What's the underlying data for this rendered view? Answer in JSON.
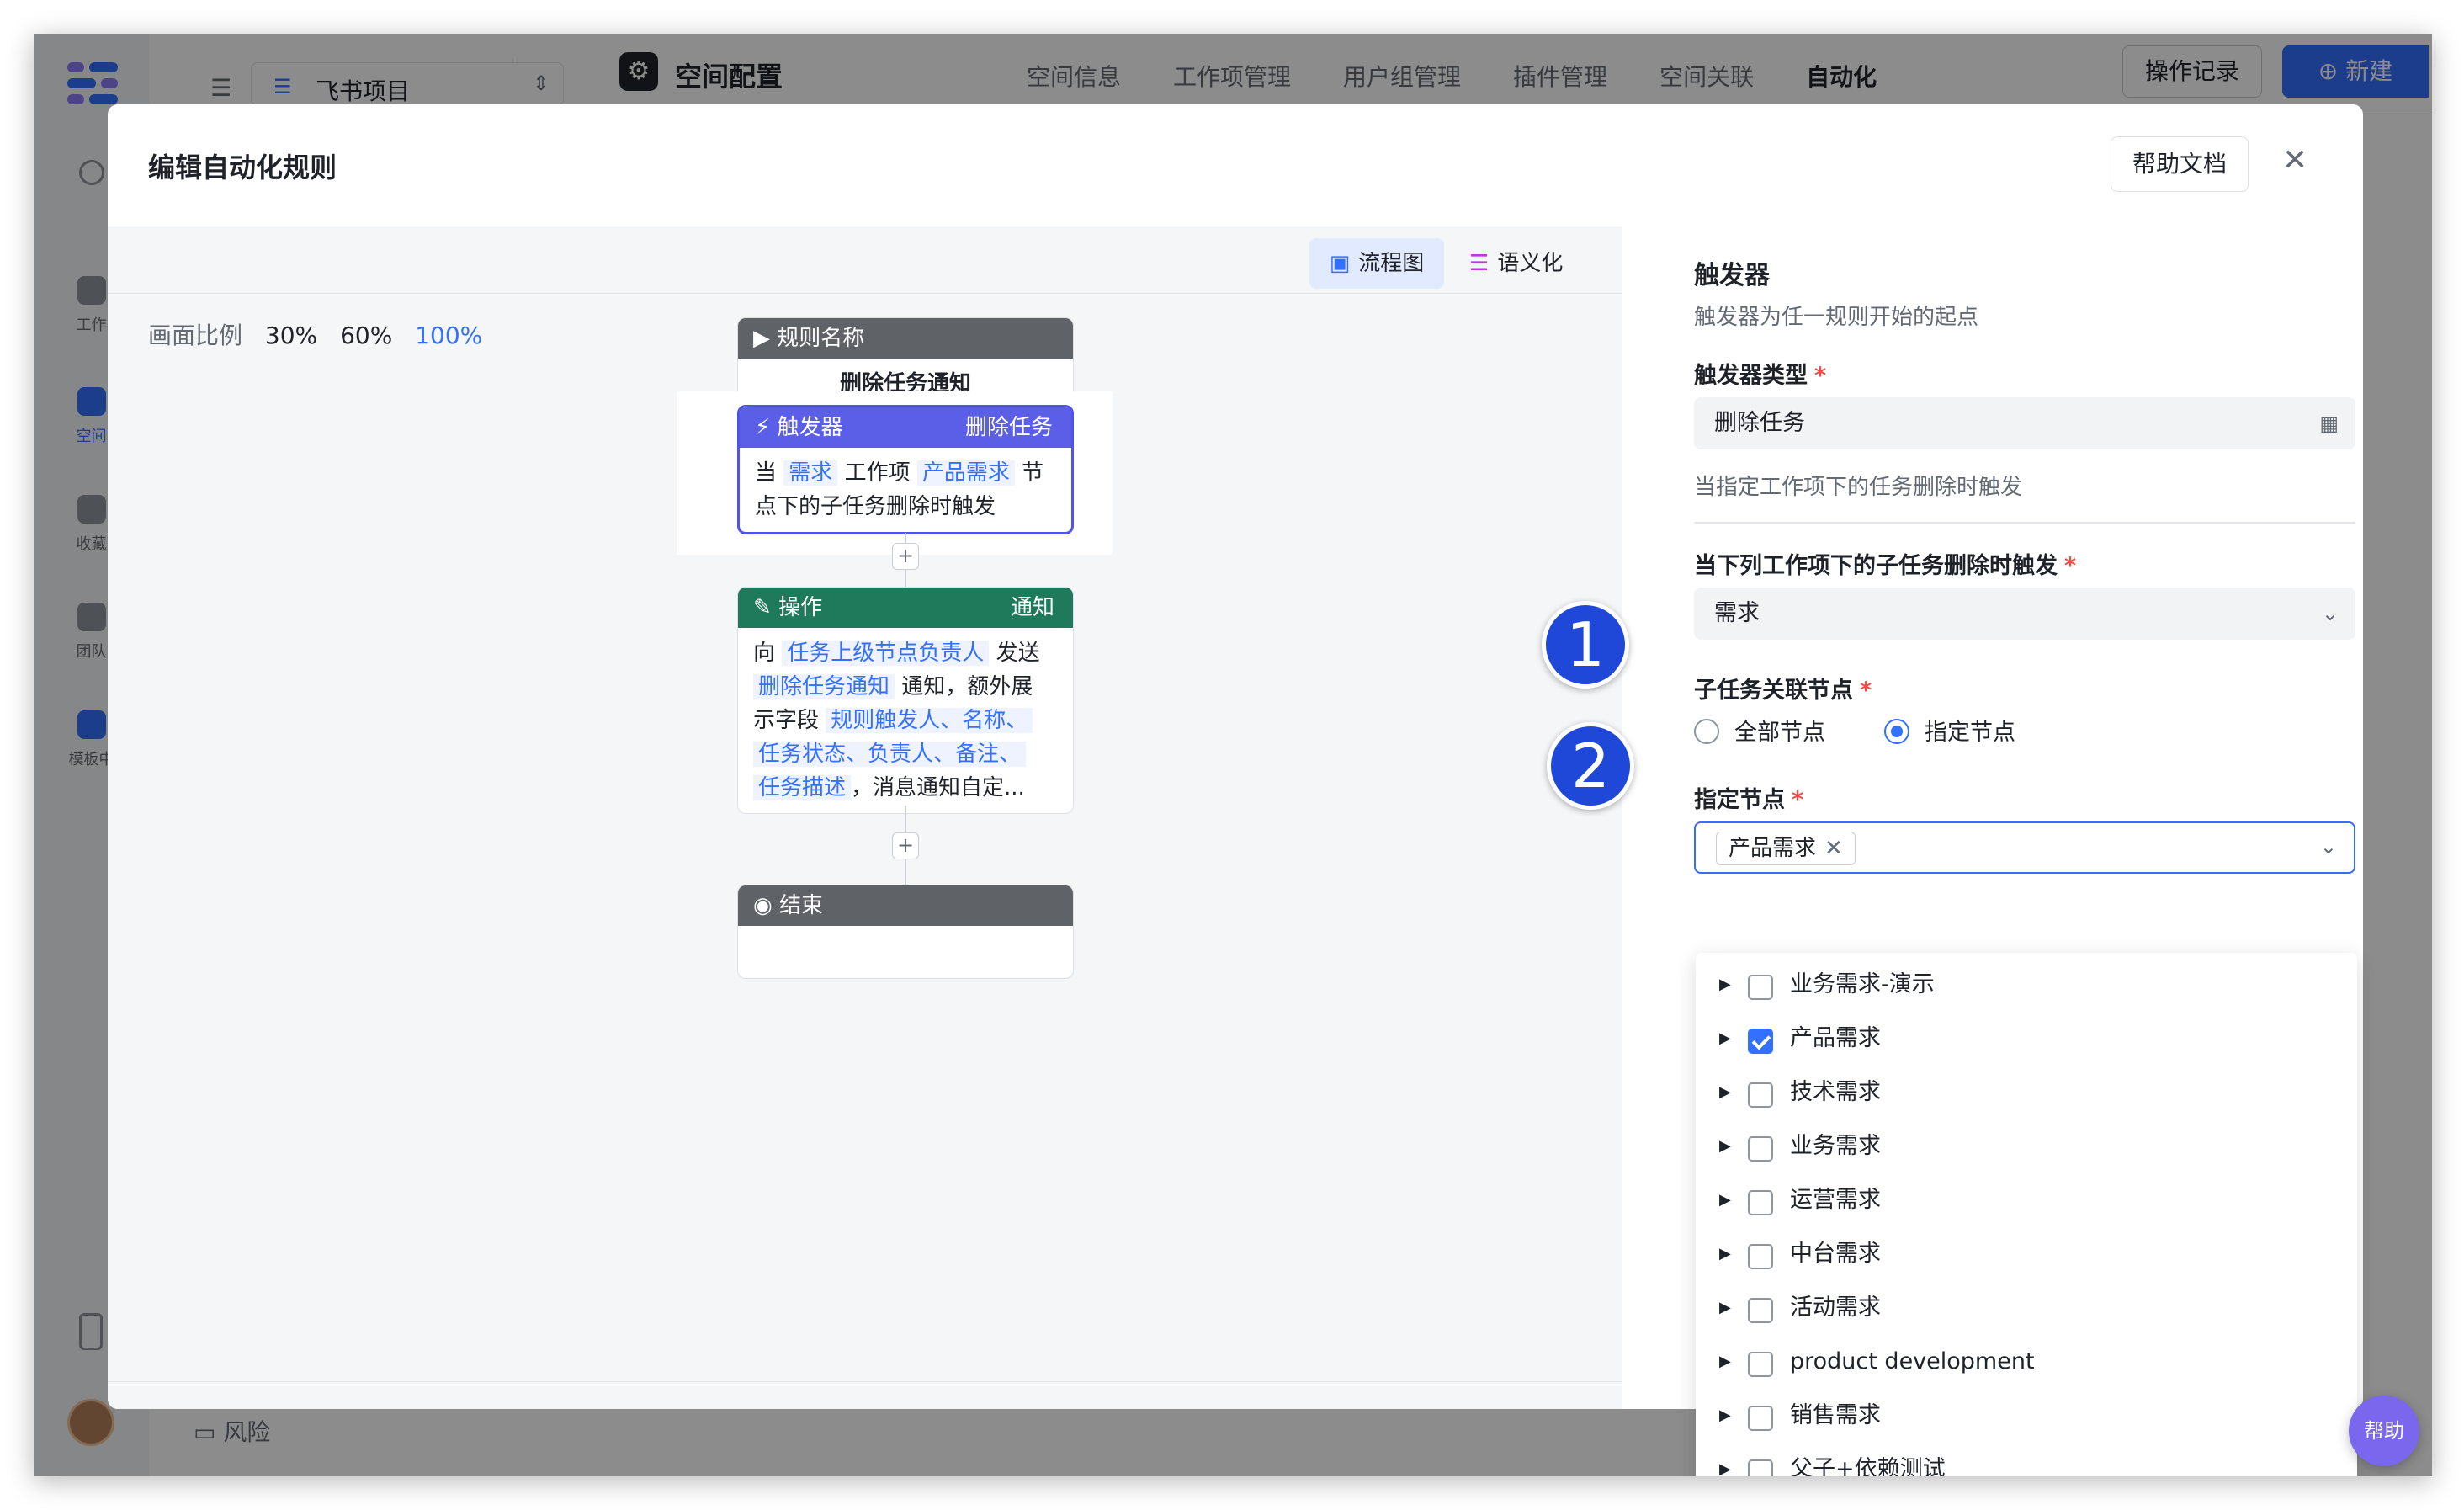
{
  "app": {
    "project_name": "飞书项目",
    "space_title": "空间配置",
    "tabs": [
      "空间信息",
      "工作项管理",
      "用户组管理",
      "插件管理",
      "空间关联",
      "自动化"
    ],
    "active_tab": "自动化",
    "operation_log": "操作记录",
    "new_button": "新建",
    "sidebar": [
      "工作",
      "空间",
      "收藏",
      "团队",
      "模板中"
    ],
    "bottom_item": "风险"
  },
  "modal": {
    "title": "编辑自动化规则",
    "help_doc": "帮助文档",
    "close": "✕",
    "views": {
      "flow": "流程图",
      "semantic": "语义化"
    },
    "zoom_label": "画面比例",
    "zoom_options": [
      "30%",
      "60%",
      "100%"
    ],
    "zoom_selected": "100%"
  },
  "flow": {
    "rule_name_header": "规则名称",
    "rule_name": "删除任务通知",
    "trigger": {
      "header": "触发器",
      "type": "删除任务",
      "p1": "当",
      "v1": "需求",
      "p2": "工作项",
      "v2": "产品需求",
      "p3": "节",
      "line2": "点下的子任务删除时触发"
    },
    "action": {
      "header": "操作",
      "type": "通知",
      "p1": "向",
      "v1": "任务上级节点负责人",
      "p2": "发送",
      "v2": "删除任务通知",
      "p3": "通知，额外展",
      "p4": "示字段",
      "v3": "规则触发人、名称、",
      "v4": "任务状态、负责人、备注、",
      "v5": "任务描述",
      "p5": "，消息通知自定..."
    },
    "end": "结束",
    "plus": "+"
  },
  "panel": {
    "title": "触发器",
    "desc": "触发器为任一规则开始的起点",
    "type_label": "触发器类型",
    "type_value": "删除任务",
    "type_hint": "当指定工作项下的任务删除时触发",
    "workitem_label": "当下列工作项下的子任务删除时触发",
    "workitem_value": "需求",
    "node_label": "子任务关联节点",
    "radio_all": "全部节点",
    "radio_specified": "指定节点",
    "specified_label": "指定节点",
    "required": "*",
    "selected_tag": "产品需求",
    "options": [
      {
        "label": "业务需求-演示",
        "checked": false
      },
      {
        "label": "产品需求",
        "checked": true
      },
      {
        "label": "技术需求",
        "checked": false
      },
      {
        "label": "业务需求",
        "checked": false
      },
      {
        "label": "运营需求",
        "checked": false
      },
      {
        "label": "中台需求",
        "checked": false
      },
      {
        "label": "活动需求",
        "checked": false
      },
      {
        "label": "product development",
        "checked": false
      },
      {
        "label": "销售需求",
        "checked": false
      },
      {
        "label": "父子+依赖测试",
        "checked": false
      }
    ]
  },
  "help_fab": "帮助",
  "annotations": [
    "1",
    "2"
  ],
  "colors": {
    "accent": "#3370ff",
    "trigger": "#5b5fe8",
    "action": "#1e7a5a",
    "name": "#5f6368"
  }
}
